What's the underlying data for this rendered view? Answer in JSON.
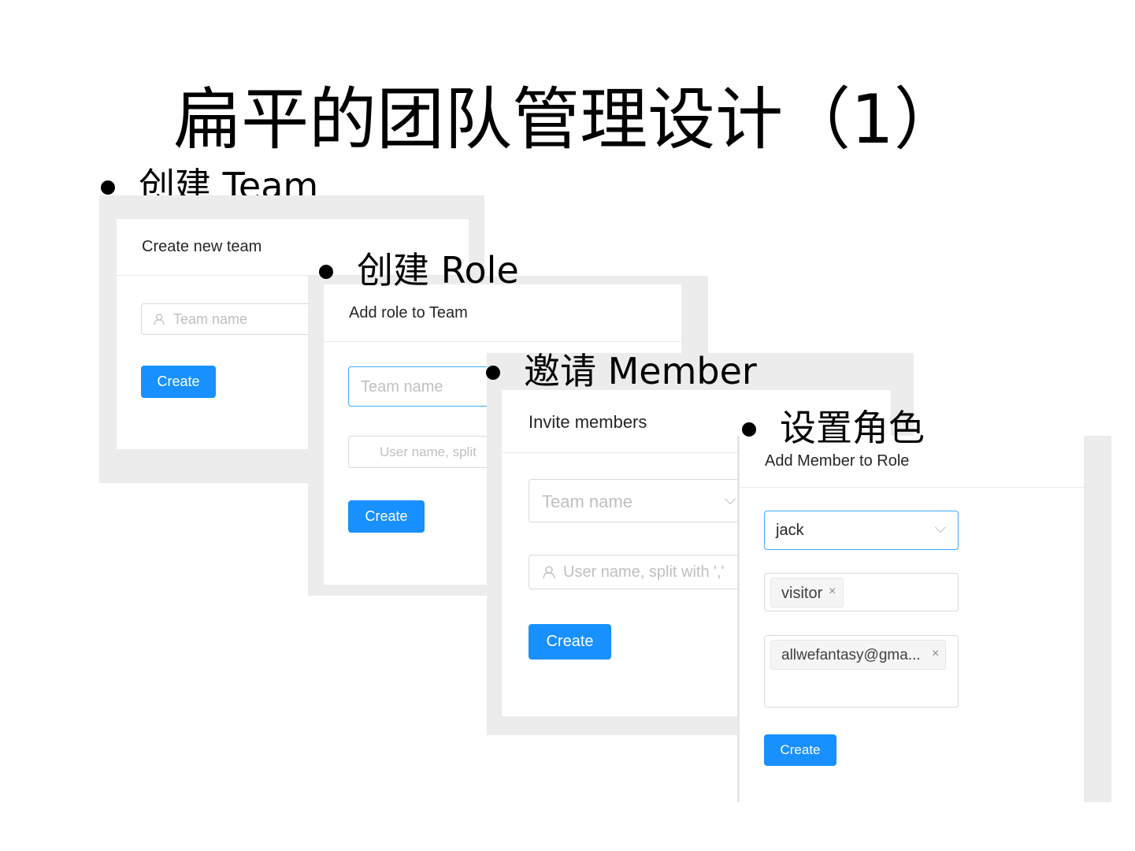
{
  "title": "扁平的团队管理设计（1）",
  "sections": [
    {
      "bullet": "创建 Team",
      "card_title": "Create new team",
      "team_name_placeholder": "Team name",
      "button": "Create"
    },
    {
      "bullet": "创建 Role",
      "card_title": "Add role to Team",
      "team_name_placeholder": "Team name",
      "user_placeholder": "User name, split",
      "button": "Create"
    },
    {
      "bullet": "邀请 Member",
      "card_title": "Invite members",
      "team_name_placeholder": "Team name",
      "user_placeholder": "User name, split with ','",
      "button": "Create"
    },
    {
      "bullet": "设置角色",
      "card_title": "Add Member to Role",
      "selected_user": "jack",
      "role_tag": "visitor",
      "member_tag": "allwefantasy@gma...",
      "button": "Create"
    }
  ],
  "tag_close": "×",
  "icons": [
    "user-icon",
    "chevron-down-icon",
    "close-icon"
  ],
  "colors": {
    "primary": "#1890ff",
    "focus_border": "#40a9ff",
    "frame": "#ececec"
  }
}
